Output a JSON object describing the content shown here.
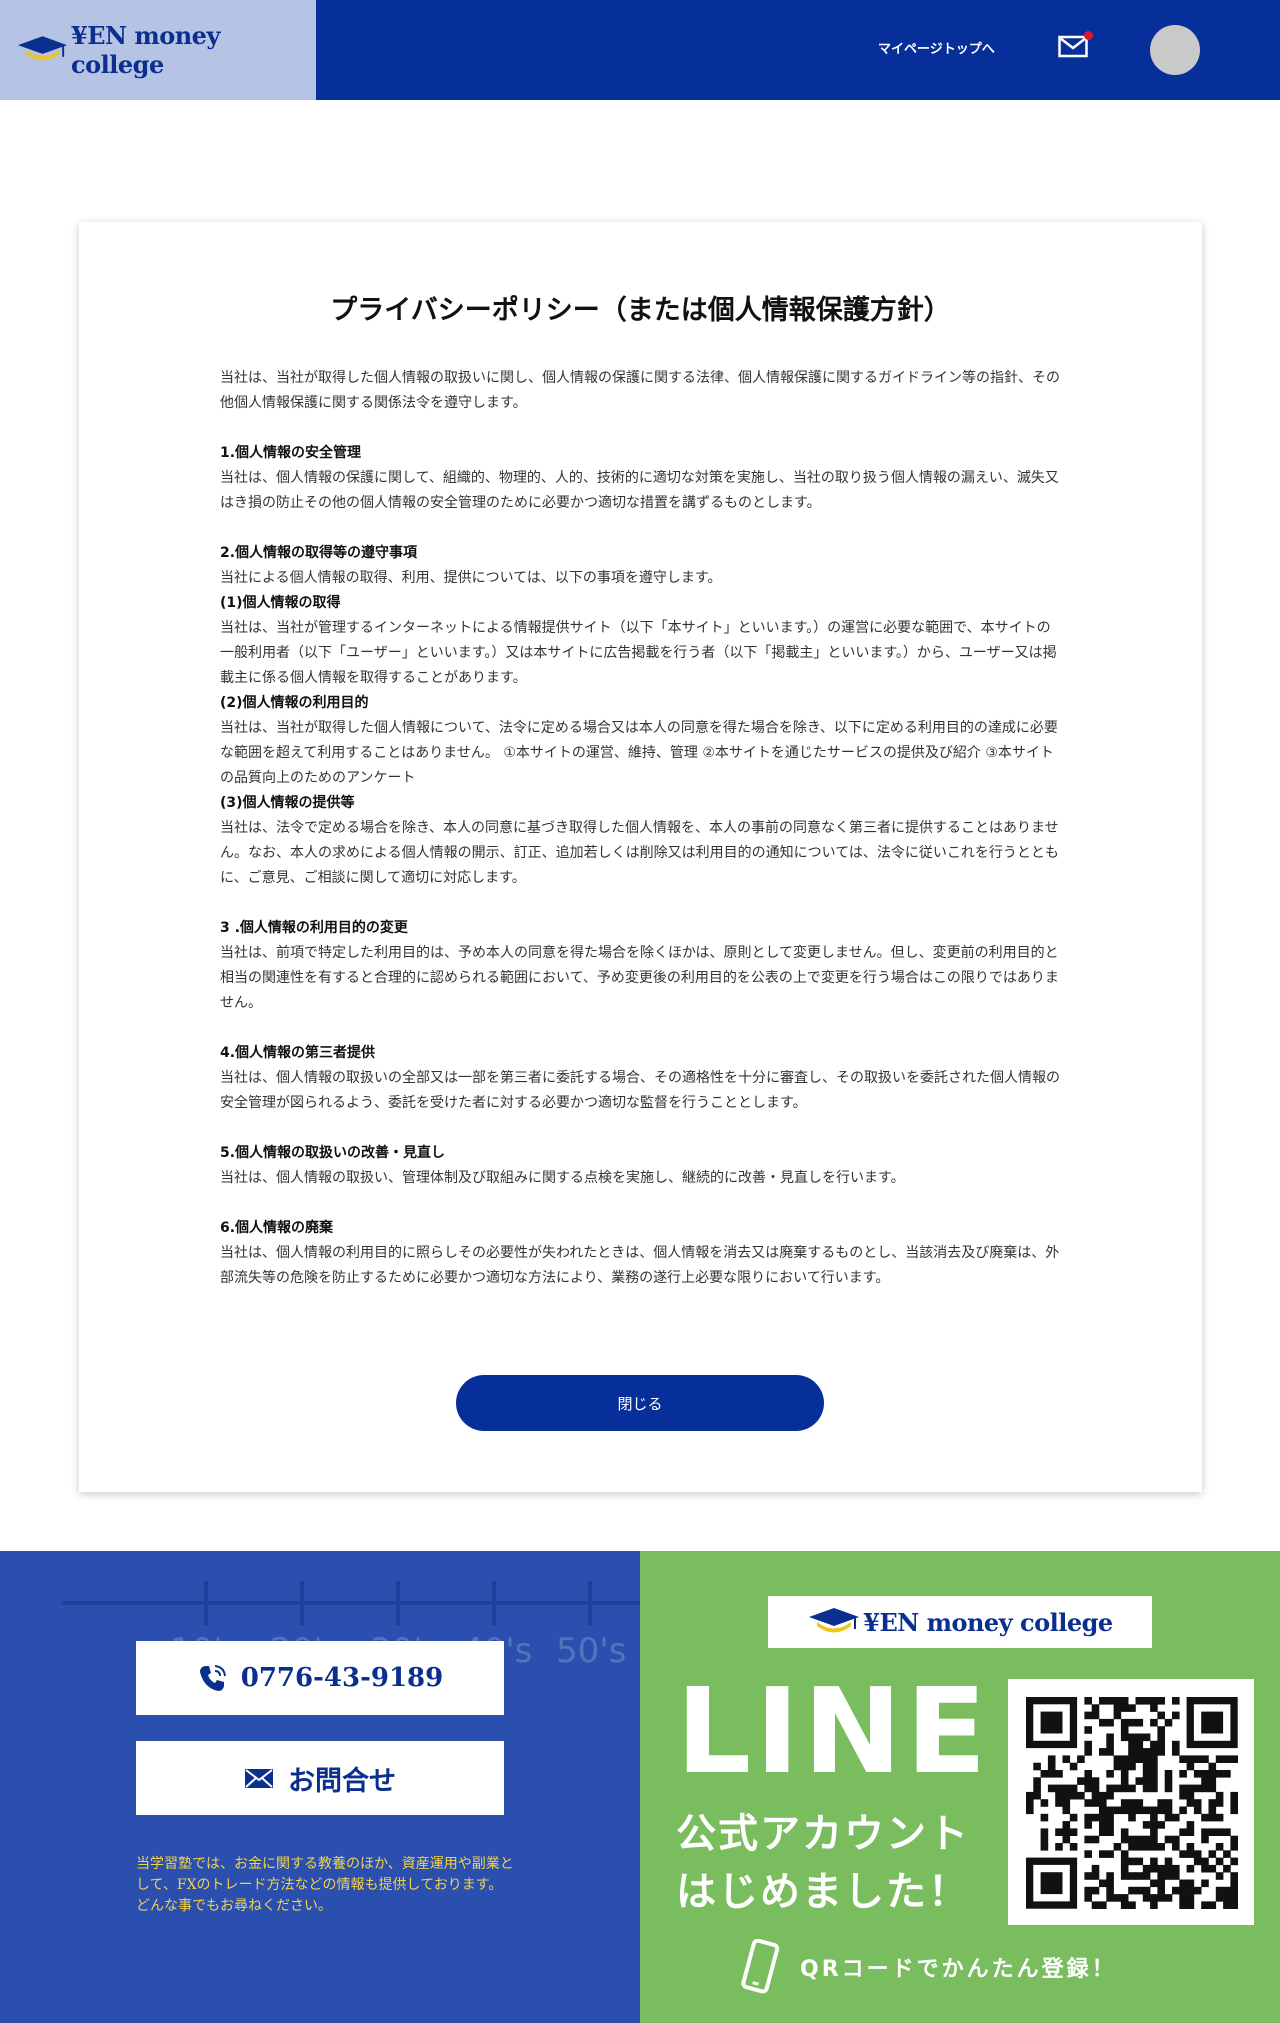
{
  "header": {
    "brand": "¥EN money college",
    "mypage_link": "マイページトップへ"
  },
  "policy": {
    "title": "プライバシーポリシー（または個人情報保護方針）",
    "intro": "当社は、当社が取得した個人情報の取扱いに関し、個人情報の保護に関する法律、個人情報保護に関するガイドライン等の指針、その他個人情報保護に関する関係法令を遵守します。",
    "s1_heading": "1.個人情報の安全管理",
    "s1_body": "当社は、個人情報の保護に関して、組織的、物理的、人的、技術的に適切な対策を実施し、当社の取り扱う個人情報の漏えい、滅失又はき損の防止その他の個人情報の安全管理のために必要かつ適切な措置を講ずるものとします。",
    "s2_heading": "2.個人情報の取得等の遵守事項",
    "s2_body": "当社による個人情報の取得、利用、提供については、以下の事項を遵守します。",
    "s2_1_heading": "(1)個人情報の取得",
    "s2_1_body": "当社は、当社が管理するインターネットによる情報提供サイト（以下「本サイト」といいます。）の運営に必要な範囲で、本サイトの一般利用者（以下「ユーザー」といいます。）又は本サイトに広告掲載を行う者（以下「掲載主」といいます。）から、ユーザー又は掲載主に係る個人情報を取得することがあります。",
    "s2_2_heading": "(2)個人情報の利用目的",
    "s2_2_body": "当社は、当社が取得した個人情報について、法令に定める場合又は本人の同意を得た場合を除き、以下に定める利用目的の達成に必要な範囲を超えて利用することはありません。 ①本サイトの運営、維持、管理 ②本サイトを通じたサービスの提供及び紹介 ③本サイトの品質向上のためのアンケート",
    "s2_3_heading": "(3)個人情報の提供等",
    "s2_3_body": "当社は、法令で定める場合を除き、本人の同意に基づき取得した個人情報を、本人の事前の同意なく第三者に提供することはありません。なお、本人の求めによる個人情報の開示、訂正、追加若しくは削除又は利用目的の通知については、法令に従いこれを行うとともに、ご意見、ご相談に関して適切に対応します。",
    "s3_heading": "3 .個人情報の利用目的の変更",
    "s3_body": "当社は、前項で特定した利用目的は、予め本人の同意を得た場合を除くほかは、原則として変更しません。但し、変更前の利用目的と相当の関連性を有すると合理的に認められる範囲において、予め変更後の利用目的を公表の上で変更を行う場合はこの限りではありません。",
    "s4_heading": "4.個人情報の第三者提供",
    "s4_body": "当社は、個人情報の取扱いの全部又は一部を第三者に委託する場合、その適格性を十分に審査し、その取扱いを委託された個人情報の安全管理が図られるよう、委託を受けた者に対する必要かつ適切な監督を行うこととします。",
    "s5_heading": "5.個人情報の取扱いの改善・見直し",
    "s5_body": "当社は、個人情報の取扱い、管理体制及び取組みに関する点検を実施し、継続的に改善・見直しを行います。",
    "s6_heading": "6.個人情報の廃棄",
    "s6_body": "当社は、個人情報の利用目的に照らしその必要性が失われたときは、個人情報を消去又は廃棄するものとし、当該消去及び廃棄は、外部流失等の危険を防止するために必要かつ適切な方法により、業務の遂行上必要な限りにおいて行います。",
    "close_label": "閉じる"
  },
  "footer": {
    "decades": [
      "10's",
      "20's",
      "30's",
      "40's",
      "50's"
    ],
    "phone": "0776-43-9189",
    "contact_label": "お問合せ",
    "note": "当学習塾では、お金に関する教養のほか、資産運用や副業として、FXのトレード方法などの情報も提供しております。どんな事でもお尋ねください。",
    "line_brand": "¥EN money college",
    "line_big": "LINE",
    "line_sub1": "公式アカウント",
    "line_sub2": "はじめました！",
    "qr_caption": "QRコードでかんたん登録！"
  },
  "colors": {
    "brand_blue": "#062f99",
    "logo_bg": "#b5c3e4",
    "footer_blue": "#2a4fae",
    "footer_green": "#79bd5f",
    "note_yellow": "#f2d34a",
    "badge_red": "#e0192c"
  }
}
